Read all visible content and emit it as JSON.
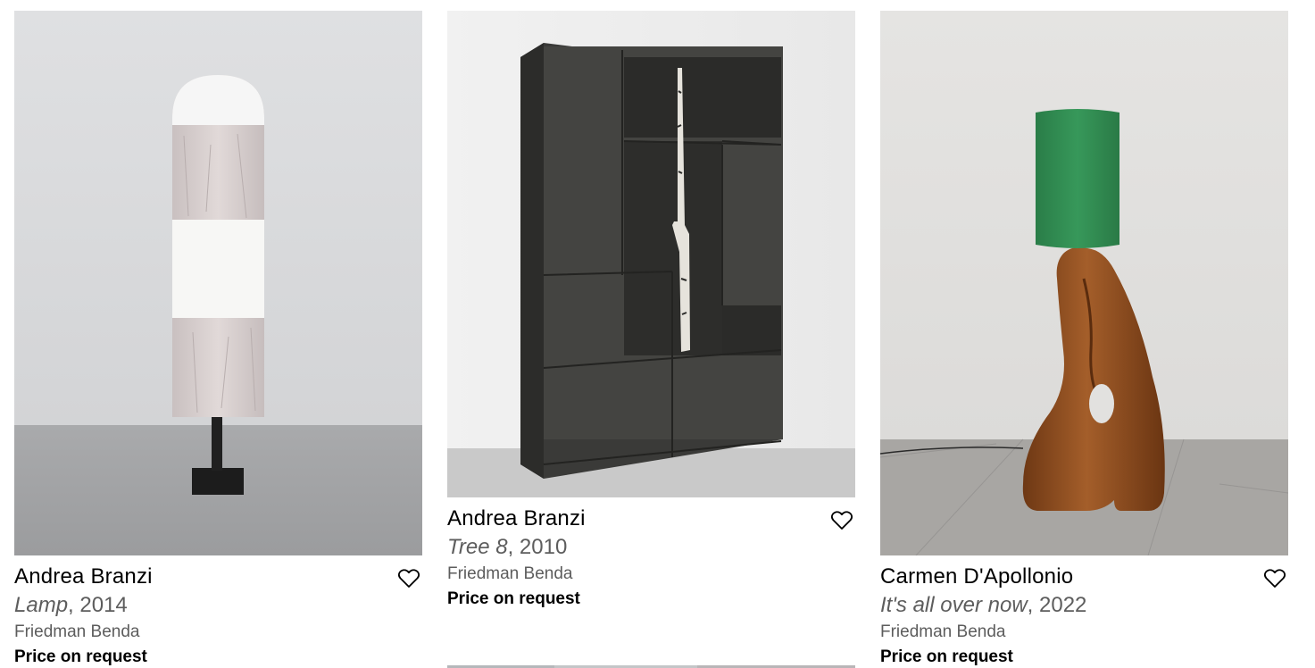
{
  "artworks": [
    {
      "artist": "Andrea Branzi",
      "title": "Lamp",
      "year": ", 2014",
      "gallery": "Friedman Benda",
      "price": "Price on request",
      "image_icon": "paper-column-lamp-image",
      "favorite_icon": "heart-outline-icon"
    },
    {
      "artist": "Andrea Branzi",
      "title": "Tree 8",
      "year": ", 2010",
      "gallery": "Friedman Benda",
      "price": "Price on request",
      "image_icon": "dark-shelving-cabinet-with-birch-branch-image",
      "favorite_icon": "heart-outline-icon"
    },
    {
      "artist": "Carmen D'Apollonio",
      "title": "It's all over now",
      "year": ", 2022",
      "gallery": "Friedman Benda",
      "price": "Price on request",
      "image_icon": "bronze-sculpture-lamp-with-green-shade-image",
      "favorite_icon": "heart-outline-icon"
    }
  ],
  "colors": {
    "text_primary": "#000000",
    "text_secondary": "#5d5d5d",
    "lampshade_green": "#2e8a50",
    "bronze": "#8a4a1e"
  }
}
